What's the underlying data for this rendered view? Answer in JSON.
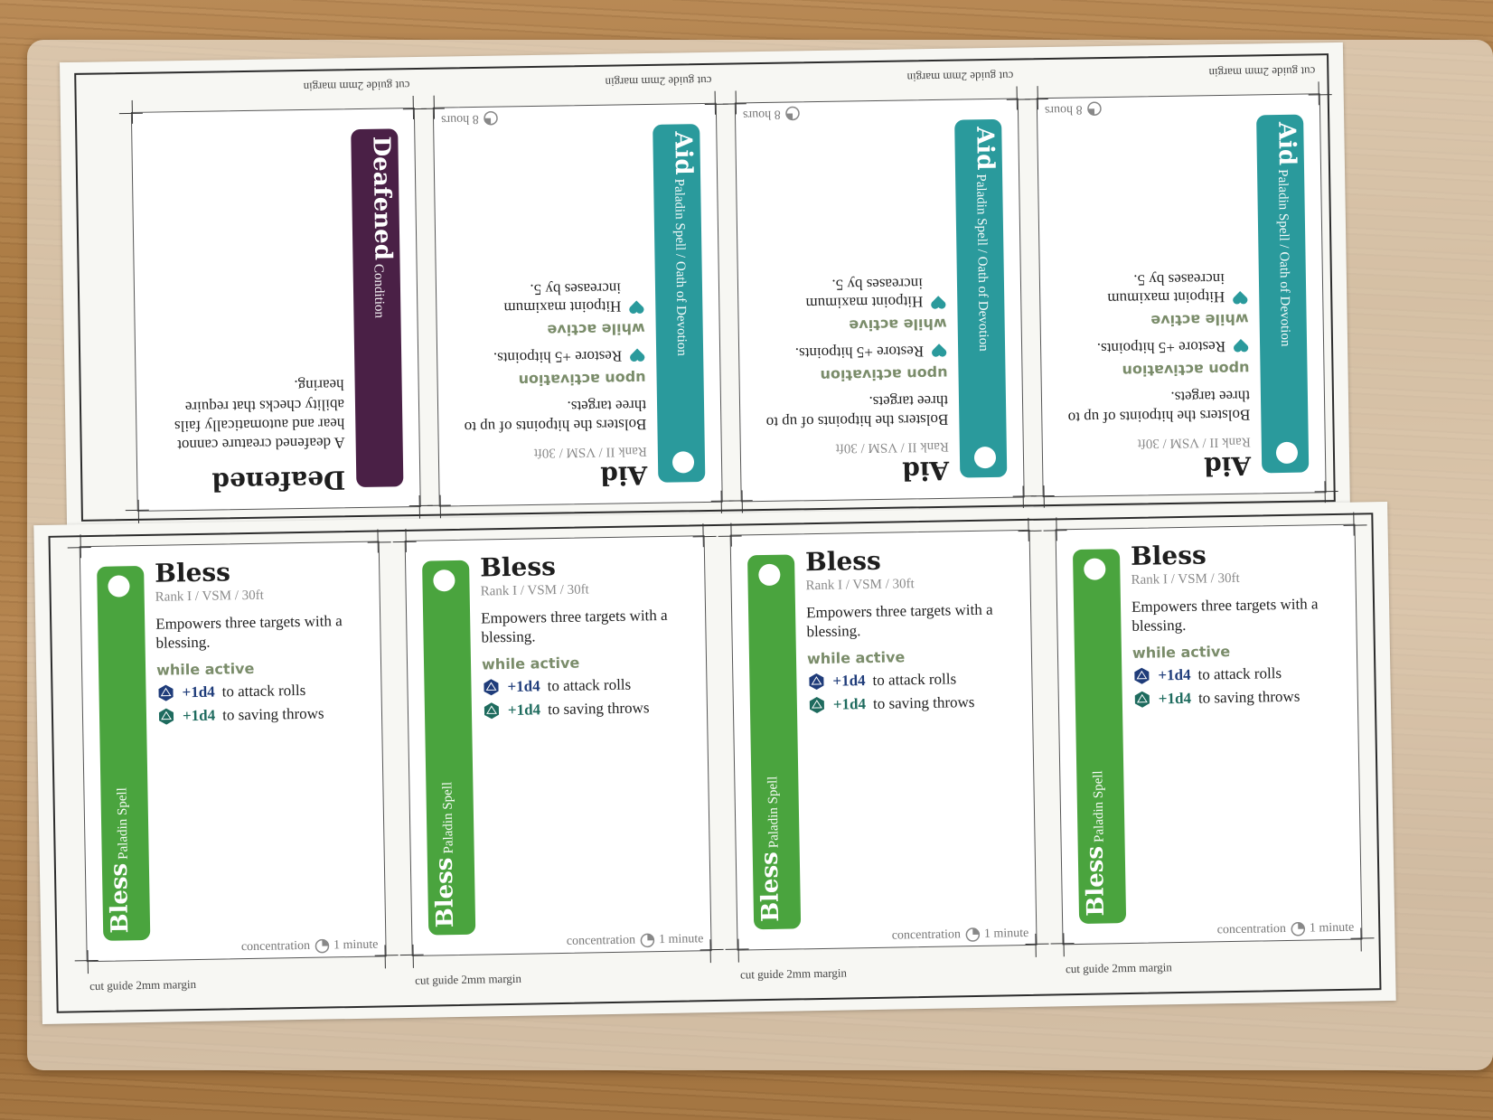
{
  "colors": {
    "aid": "#2a9a9c",
    "bless": "#4aa43e",
    "deafened": "#4a2046",
    "d20_blue": "#1f3c7a",
    "d20_teal": "#1e6b5e",
    "label_green": "#7a8c6a"
  },
  "cut_guide": "cut guide 2mm margin",
  "top_row": [
    {
      "kind": "condition",
      "bar_title": "Deafened",
      "bar_subtitle": "Condition",
      "title": "Deafened",
      "description": "A deafened creature cannot hear and automatically fails ability checks that require hearing."
    },
    {
      "kind": "aid",
      "bar_title": "Aid",
      "bar_subtitle": "Paladin Spell / Oath of Devotion",
      "title": "Aid",
      "meta": "Rank II / VSM / 30ft",
      "description": "Bolsters the hitpoints of up to three targets.",
      "upon_label": "upon activation",
      "upon_effect": "Restore +5 hitpoints.",
      "while_label": "while active",
      "while_effect": "Hitpoint maximum increases by 5.",
      "duration": "8 hours"
    },
    {
      "kind": "aid",
      "bar_title": "Aid",
      "bar_subtitle": "Paladin Spell / Oath of Devotion",
      "title": "Aid",
      "meta": "Rank II / VSM / 30ft",
      "description": "Bolsters the hitpoints of up to three targets.",
      "upon_label": "upon activation",
      "upon_effect": "Restore +5 hitpoints.",
      "while_label": "while active",
      "while_effect": "Hitpoint maximum increases by 5.",
      "duration": "8 hours"
    },
    {
      "kind": "aid",
      "bar_title": "Aid",
      "bar_subtitle": "Paladin Spell / Oath of Devotion",
      "title": "Aid",
      "meta": "Rank II / VSM / 30ft",
      "description": "Bolsters the hitpoints of up to three targets.",
      "upon_label": "upon activation",
      "upon_effect": "Restore +5 hitpoints.",
      "while_label": "while active",
      "while_effect": "Hitpoint maximum increases by 5.",
      "duration": "8 hours"
    }
  ],
  "bottom_row": [
    {
      "bar_title": "Bless",
      "bar_subtitle": "Paladin Spell",
      "title": "Bless",
      "meta": "Rank I / VSM / 30ft",
      "description": "Empowers three targets with a blessing.",
      "while_label": "while active",
      "effect1_num": "+1d4",
      "effect1_text": "to attack rolls",
      "effect2_num": "+1d4",
      "effect2_text": "to saving throws",
      "footer_label": "concentration",
      "duration": "1 minute"
    },
    {
      "bar_title": "Bless",
      "bar_subtitle": "Paladin Spell",
      "title": "Bless",
      "meta": "Rank I / VSM / 30ft",
      "description": "Empowers three targets with a blessing.",
      "while_label": "while active",
      "effect1_num": "+1d4",
      "effect1_text": "to attack rolls",
      "effect2_num": "+1d4",
      "effect2_text": "to saving throws",
      "footer_label": "concentration",
      "duration": "1 minute"
    },
    {
      "bar_title": "Bless",
      "bar_subtitle": "Paladin Spell",
      "title": "Bless",
      "meta": "Rank I / VSM / 30ft",
      "description": "Empowers three targets with a blessing.",
      "while_label": "while active",
      "effect1_num": "+1d4",
      "effect1_text": "to attack rolls",
      "effect2_num": "+1d4",
      "effect2_text": "to saving throws",
      "footer_label": "concentration",
      "duration": "1 minute"
    },
    {
      "bar_title": "Bless",
      "bar_subtitle": "Paladin Spell",
      "title": "Bless",
      "meta": "Rank I / VSM / 30ft",
      "description": "Empowers three targets with a blessing.",
      "while_label": "while active",
      "effect1_num": "+1d4",
      "effect1_text": "to attack rolls",
      "effect2_num": "+1d4",
      "effect2_text": "to saving throws",
      "footer_label": "concentration",
      "duration": "1 minute"
    }
  ]
}
